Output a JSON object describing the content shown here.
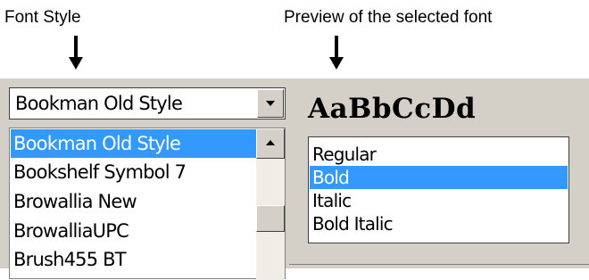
{
  "annotations": {
    "font_style": "Font Style",
    "preview_note": "Preview of the selected font"
  },
  "font_combo": {
    "value": "Bookman Old Style"
  },
  "font_list": {
    "items": [
      {
        "label": "Bookman Old Style",
        "selected": true
      },
      {
        "label": "Bookshelf Symbol 7",
        "selected": false
      },
      {
        "label": "Browallia New",
        "selected": false
      },
      {
        "label": "BrowalliaUPC",
        "selected": false
      },
      {
        "label": "Brush455 BT",
        "selected": false
      }
    ]
  },
  "preview": {
    "sample": "AaBbCcDd"
  },
  "style_list": {
    "items": [
      {
        "label": "Regular",
        "selected": false
      },
      {
        "label": "Bold",
        "selected": true
      },
      {
        "label": "Italic",
        "selected": false
      },
      {
        "label": "Bold Italic",
        "selected": false
      }
    ]
  },
  "colors": {
    "selection": "#3399ff",
    "face": "#d4d0c8"
  },
  "icons": {
    "combo_arrow": "chevron-down-icon",
    "scroll_up": "arrow-up-icon",
    "annotation_arrow": "arrow-down-icon"
  }
}
